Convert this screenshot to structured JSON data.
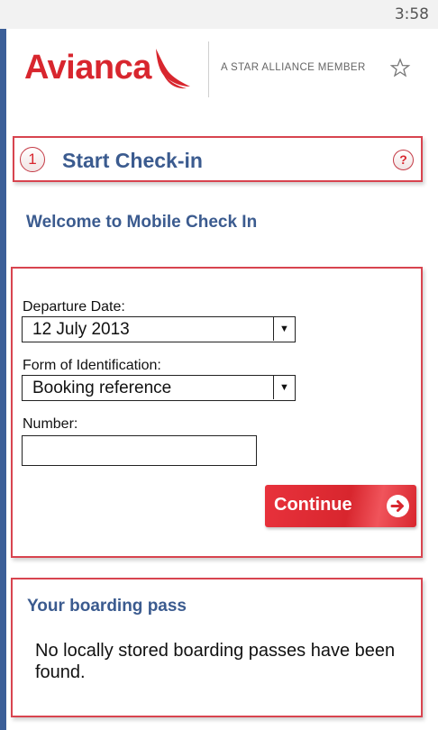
{
  "status_bar": {
    "time": "3:58"
  },
  "header": {
    "logo_text": "Avianca",
    "alliance_text": "A STAR ALLIANCE MEMBER"
  },
  "step": {
    "number": "1",
    "title": "Start Check-in",
    "help_glyph": "?"
  },
  "welcome": "Welcome to Mobile Check In",
  "form": {
    "departure_label": "Departure Date:",
    "departure_value": "12 July 2013",
    "identification_label": "Form of Identification:",
    "identification_value": "Booking reference",
    "number_label": "Number:",
    "number_value": "",
    "continue_label": "Continue"
  },
  "boarding": {
    "title": "Your boarding pass",
    "message": "No locally stored boarding passes have been found."
  },
  "colors": {
    "brand_red": "#d8262e",
    "heading_blue": "#3b5b8f",
    "panel_border": "#d8444f"
  },
  "icons": [
    "avianca-bird-icon",
    "star-alliance-icon",
    "help-icon",
    "dropdown-arrow-icon",
    "arrow-right-icon"
  ]
}
